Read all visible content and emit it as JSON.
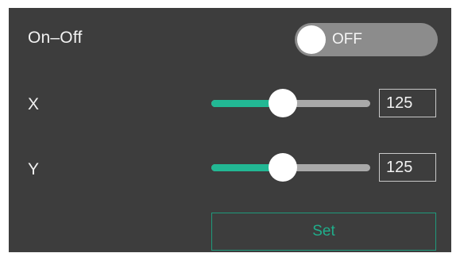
{
  "power": {
    "label": "On–Off",
    "state_text": "OFF",
    "on": false
  },
  "x": {
    "label": "X",
    "value": "125",
    "level": 0.45
  },
  "y": {
    "label": "Y",
    "value": "125",
    "level": 0.45
  },
  "set_button": {
    "label": "Set"
  },
  "colors": {
    "panel": "#3d3d3d",
    "accent": "#22b894",
    "track": "#a9a9a9",
    "toggle_off": "#8c8c8c"
  }
}
